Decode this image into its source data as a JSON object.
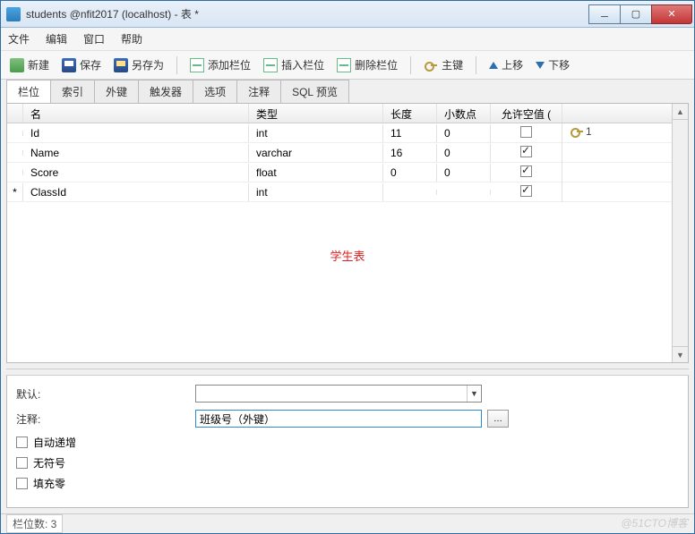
{
  "window": {
    "title": "students @nfit2017 (localhost) - 表 *"
  },
  "menu": {
    "file": "文件",
    "edit": "编辑",
    "window": "窗口",
    "help": "帮助"
  },
  "toolbar": {
    "new": "新建",
    "save": "保存",
    "saveas": "另存为",
    "addfield": "添加栏位",
    "insertfield": "插入栏位",
    "delfield": "删除栏位",
    "pkey": "主键",
    "moveup": "上移",
    "movedown": "下移"
  },
  "tabs": [
    "栏位",
    "索引",
    "外键",
    "触发器",
    "选项",
    "注释",
    "SQL 预览"
  ],
  "grid": {
    "headers": {
      "name": "名",
      "type": "类型",
      "length": "长度",
      "decimal": "小数点",
      "nullable": "允许空值 (",
      "key": ""
    },
    "rows": [
      {
        "mark": "",
        "name": "Id",
        "type": "int",
        "length": "11",
        "decimal": "0",
        "nullable": false,
        "key": "1"
      },
      {
        "mark": "",
        "name": "Name",
        "type": "varchar",
        "length": "16",
        "decimal": "0",
        "nullable": true,
        "key": ""
      },
      {
        "mark": "",
        "name": "Score",
        "type": "float",
        "length": "0",
        "decimal": "0",
        "nullable": true,
        "key": ""
      },
      {
        "mark": "*",
        "name": "ClassId",
        "type": "int",
        "length": "",
        "decimal": "",
        "nullable": true,
        "key": ""
      }
    ],
    "redlabel": "学生表"
  },
  "bottom": {
    "default_label": "默认:",
    "default_value": "",
    "comment_label": "注释:",
    "comment_value": "班级号（外键）",
    "auto_inc": "自动递增",
    "unsigned": "无符号",
    "zerofill": "填充零"
  },
  "status": {
    "text": "栏位数: 3"
  },
  "watermark": "@51CTO博客"
}
